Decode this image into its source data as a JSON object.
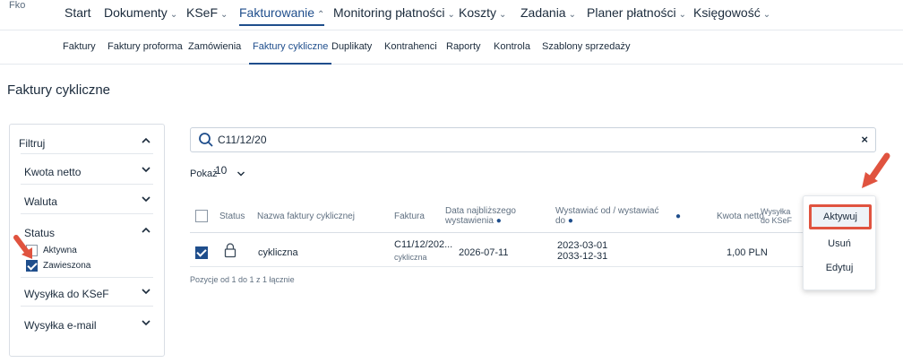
{
  "brand": "Fko",
  "top_nav": [
    {
      "label": "Start",
      "chevron": ""
    },
    {
      "label": "Dokumenty",
      "chevron": "⌄"
    },
    {
      "label": "KSeF",
      "chevron": "⌄"
    },
    {
      "label": "Fakturowanie",
      "chevron": "⌃"
    },
    {
      "label": "Monitoring płatności",
      "chevron": "⌄"
    },
    {
      "label": "Koszty",
      "chevron": "⌄"
    },
    {
      "label": "Zadania",
      "chevron": "⌄"
    },
    {
      "label": "Planer płatności",
      "chevron": "⌄"
    },
    {
      "label": "Księgowość",
      "chevron": "⌄"
    }
  ],
  "sub_nav": [
    "Faktury",
    "Faktury proforma",
    "Zamówienia",
    "Faktury cykliczne",
    "Duplikaty",
    "Kontrahenci",
    "Raporty",
    "Kontrola",
    "Szablony sprzedaży"
  ],
  "page_title": "Faktury cykliczne",
  "filter": {
    "header": "Filtruj",
    "sections": [
      "Kwota netto",
      "Waluta",
      "Status",
      "Wysyłka do KSeF",
      "Wysyłka e-mail"
    ],
    "status_options": [
      {
        "label": "Aktywna",
        "checked": false
      },
      {
        "label": "Zawieszona",
        "checked": true
      }
    ]
  },
  "search": {
    "value": "C11/12/20",
    "clear": "×"
  },
  "show": {
    "label": "Pokaż",
    "value": "10"
  },
  "table": {
    "headers": {
      "status": "Status",
      "name": "Nazwa faktury cyklicznej",
      "invoice": "Faktura",
      "next_date_1": "Data najbliższego",
      "next_date_2": "wystawienia",
      "issue_1": "Wystawiać od / wystawiać",
      "issue_2": "do",
      "net": "Kwota netto",
      "ksef_1": "Wysyłka",
      "ksef_2": "do KSeF"
    },
    "row": {
      "name": "cykliczna",
      "invoice_number": "C11/12/202...",
      "invoice_sub": "cykliczna",
      "next_date": "2026-07-11",
      "issue_from": "2023-03-01",
      "issue_to": "2033-12-31",
      "net": "1,00 PLN"
    },
    "footer": "Pozycje od 1 do 1 z 1 łącznie"
  },
  "context_menu": [
    "Aktywuj",
    "Usuń",
    "Edytuj"
  ],
  "colors": {
    "accent": "#1f4e8c",
    "annotation": "#e0533f"
  }
}
